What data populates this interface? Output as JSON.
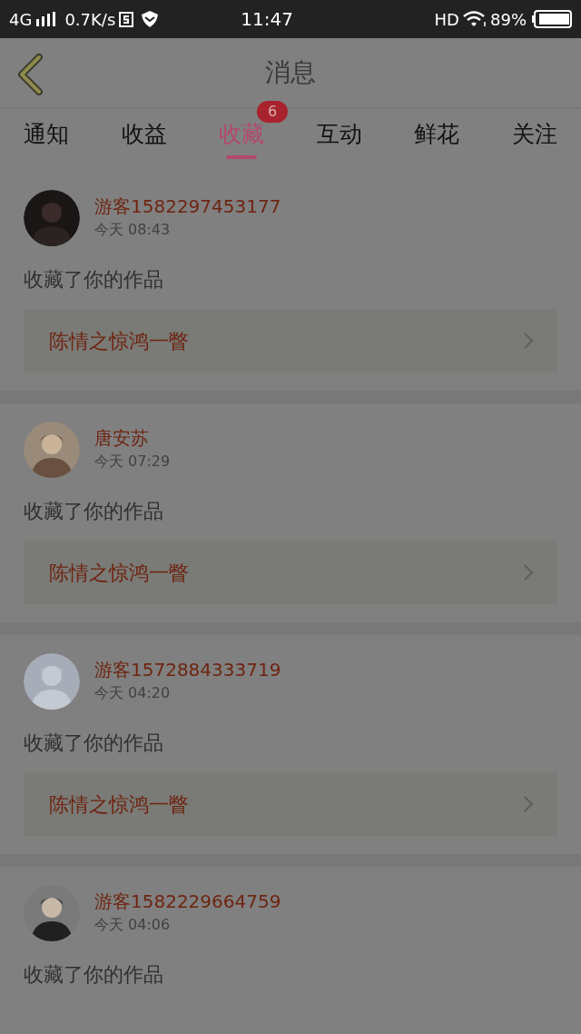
{
  "status_bar": {
    "network": "4G",
    "speed": "0.7K/s",
    "time": "11:47",
    "hd": "HD",
    "battery": "89%"
  },
  "header": {
    "title": "消息"
  },
  "tabs": [
    {
      "label": "通知",
      "selected": false
    },
    {
      "label": "收益",
      "selected": false
    },
    {
      "label": "收藏",
      "selected": true,
      "badge": "6"
    },
    {
      "label": "互动",
      "selected": false
    },
    {
      "label": "鲜花",
      "selected": false
    },
    {
      "label": "关注",
      "selected": false
    }
  ],
  "messages": [
    {
      "user": "游客1582297453177",
      "time": "今天 08:43",
      "text": "收藏了你的作品",
      "work": "陈情之惊鸿一瞥"
    },
    {
      "user": "唐安苏",
      "time": "今天 07:29",
      "text": "收藏了你的作品",
      "work": "陈情之惊鸿一瞥"
    },
    {
      "user": "游客1572884333719",
      "time": "今天 04:20",
      "text": "收藏了你的作品",
      "work": "陈情之惊鸿一瞥"
    },
    {
      "user": "游客1582229664759",
      "time": "今天 04:06",
      "text": "收藏了你的作品"
    }
  ]
}
